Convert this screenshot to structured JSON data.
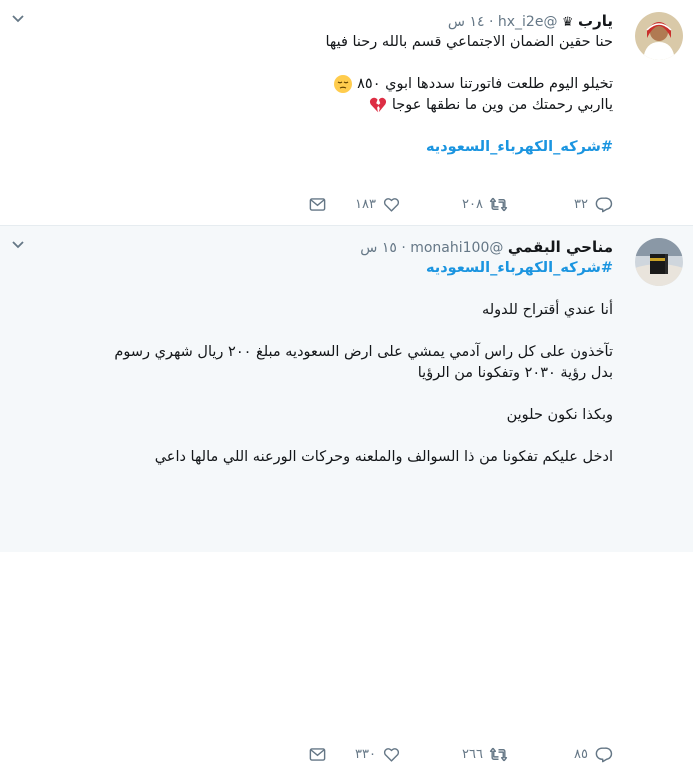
{
  "tweets": [
    {
      "name": "يارب",
      "handle": "@hx_i2e",
      "dot": "·",
      "time": "١٤ س",
      "lines": [
        "حنا حقين الضمان الاجتماعي قسم بالله رحنا فيها",
        "",
        "تخيلو اليوم طلعت فاتورتنا سددها ابوي ٨٥٠",
        "يااربي رحمتك من وين ما نطقها عوجا",
        ""
      ],
      "hashtag": "#شركه_الكهرباء_السعوديه",
      "replies": "٣٢",
      "retweets": "٢٠٨",
      "likes": "١٨٣"
    },
    {
      "name": "مناحي البقمي",
      "handle": "@monahi100",
      "dot": "·",
      "time": "١٥ س",
      "hashtag": "#شركه_الكهرباء_السعوديه",
      "lines": [
        "",
        "أنا عندي أقتراح للدوله",
        "",
        "تآخذون على كل راس آدمي يمشي على ارض السعوديه مبلغ ٢٠٠ ريال شهري رسوم",
        "بدل رؤية ٢٠٣٠ وتفكونا من الرؤيا",
        "",
        "وبكذا نكون حلوين",
        "",
        "ادخل عليكم تفكونا من ذا السوالف والملعنه وحركات الورعنه اللي مالها داعي"
      ],
      "replies": "٨٥",
      "retweets": "٢٦٦",
      "likes": "٣٣٠"
    }
  ],
  "icons": {
    "reply": "reply-icon",
    "retweet": "retweet-icon",
    "like": "heart-icon",
    "message": "envelope-icon",
    "caret": "chevron-down-icon",
    "crown": "crown-icon"
  },
  "colors": {
    "text": "#14171a",
    "muted": "#657786",
    "link": "#1b95e0",
    "highlight_bg": "#f5f8fa"
  }
}
